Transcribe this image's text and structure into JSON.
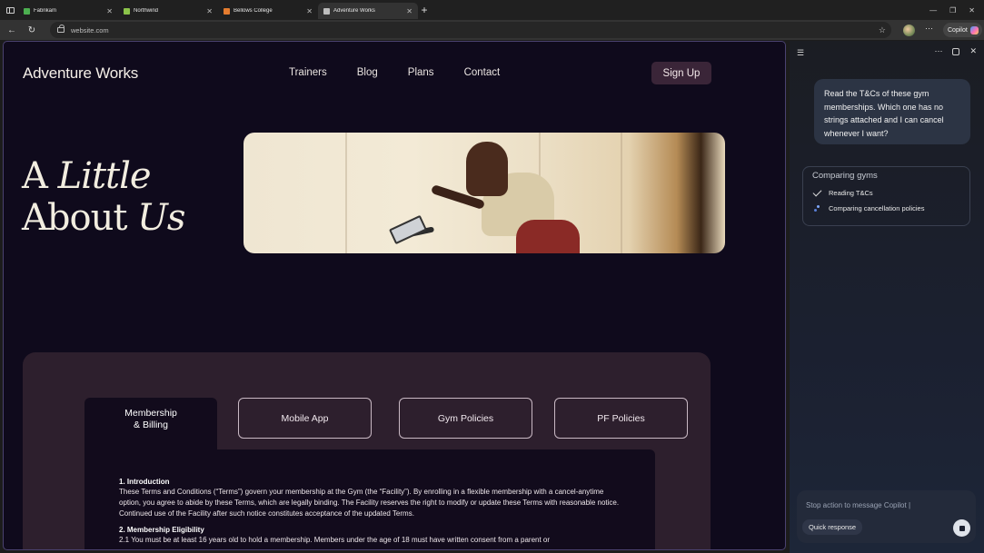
{
  "browser": {
    "tabs": [
      {
        "label": "Fabrikam",
        "color": "#4caf50"
      },
      {
        "label": "Northwind",
        "color": "#8bc34a"
      },
      {
        "label": "Bellows College",
        "color": "#e57c2f"
      },
      {
        "label": "Adventure Works",
        "color": "#bdbdbd"
      }
    ],
    "url": "website.com",
    "copilot_label": "Copilot"
  },
  "site": {
    "brand": "Adventure Works",
    "nav": [
      "Trainers",
      "Blog",
      "Plans",
      "Contact"
    ],
    "signup": "Sign Up",
    "hero": {
      "word1": "A",
      "word2": "Little",
      "word3": "About",
      "word4": "Us"
    },
    "tabs": {
      "active_line1": "Membership",
      "active_line2": "& Billing",
      "mobile": "Mobile App",
      "gym": "Gym Policies",
      "pf": "PF Policies"
    },
    "terms": {
      "h1": "1. Introduction",
      "p1": "These Terms and Conditions (“Terms”) govern your membership at the Gym (the “Facility”). By enrolling in a flexible membership with a cancel-anytime option, you agree to abide by these Terms, which are legally binding. The Facility reserves the right to modify or update these Terms with reasonable notice. Continued use of the Facility after such notice constitutes acceptance of the updated Terms.",
      "h2": "2. Membership Eligibility",
      "p2": "2.1 You must be at least 16 years old to hold a membership. Members under the age of 18 must have written consent from a parent or"
    }
  },
  "copilot": {
    "user_message": "Read the T&Cs of these gym memberships. Which one has no strings attached and I can cancel whenever I want?",
    "progress_title": "Comparing gyms",
    "step1": "Reading T&Cs",
    "step2": "Comparing cancellation policies",
    "placeholder": "Stop action to message Copilot |",
    "quick_response": "Quick response"
  }
}
